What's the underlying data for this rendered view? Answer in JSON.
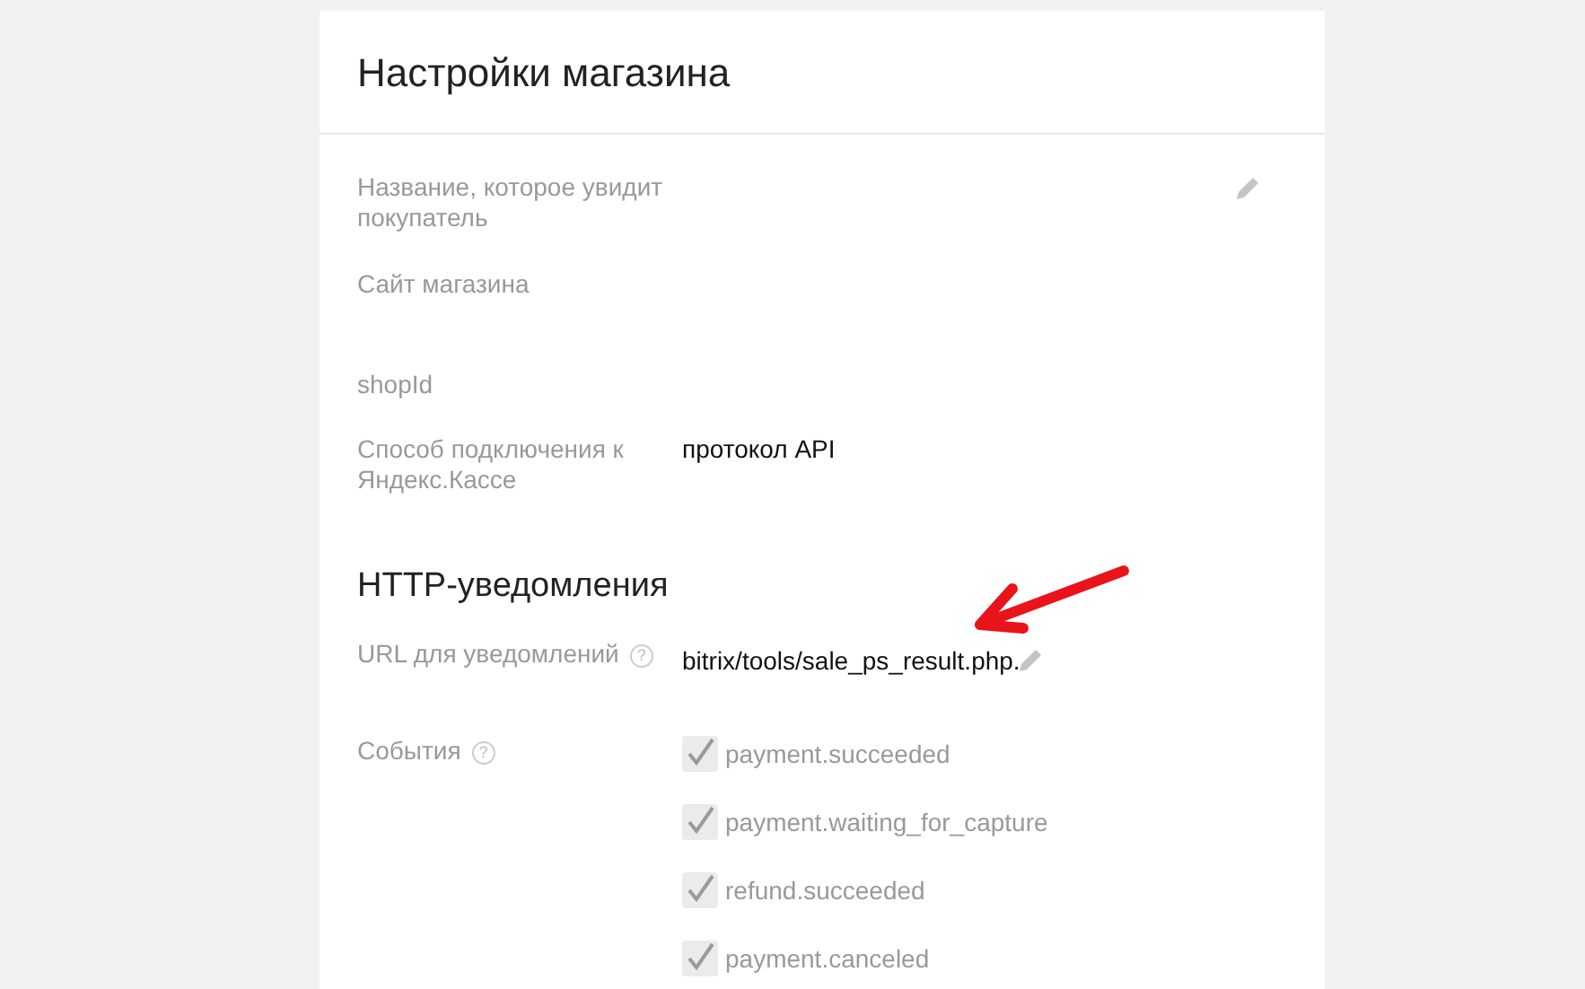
{
  "card": {
    "title": "Настройки магазина"
  },
  "shop_fields": [
    {
      "label": "Название, которое увидит покупатель",
      "editable": true
    },
    {
      "label": "Сайт магазина",
      "editable": false
    },
    {
      "label": "shopId",
      "editable": false
    },
    {
      "label": "Способ подключения к Яндекс.Кассе",
      "value": "протокол API",
      "editable": false
    }
  ],
  "http_section": {
    "heading": "HTTP-уведомления",
    "url_field": {
      "label": "URL для уведомлений",
      "help": "?",
      "value": "bitrix/tools/sale_ps_result.php.",
      "editable": true
    },
    "events": {
      "label": "События",
      "help": "?",
      "items": [
        {
          "label": "payment.succeeded",
          "checked": true,
          "disabled": true
        },
        {
          "label": "payment.waiting_for_capture",
          "checked": true,
          "disabled": true
        },
        {
          "label": "refund.succeeded",
          "checked": true,
          "disabled": true
        },
        {
          "label": "payment.canceled",
          "checked": true,
          "disabled": true
        }
      ]
    }
  }
}
